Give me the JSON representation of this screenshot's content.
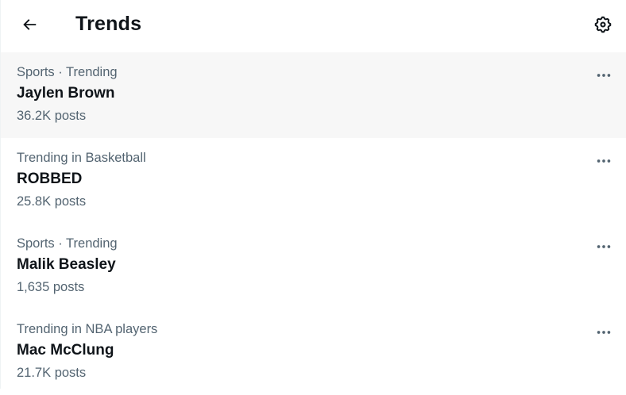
{
  "header": {
    "title": "Trends",
    "back_icon": "arrow-left-icon",
    "settings_icon": "gear-icon"
  },
  "trends": [
    {
      "context": "Sports · Trending",
      "name": "Jaylen Brown",
      "count": "36.2K posts",
      "highlighted": true
    },
    {
      "context": "Trending in Basketball",
      "name": "ROBBED",
      "count": "25.8K posts",
      "highlighted": false
    },
    {
      "context": "Sports · Trending",
      "name": "Malik Beasley",
      "count": "1,635 posts",
      "highlighted": false
    },
    {
      "context": "Trending in NBA players",
      "name": "Mac McClung",
      "count": "21.7K posts",
      "highlighted": false
    }
  ],
  "colors": {
    "text_primary": "#0f1419",
    "text_secondary": "#536471",
    "hover_bg": "#f7f7f7"
  }
}
